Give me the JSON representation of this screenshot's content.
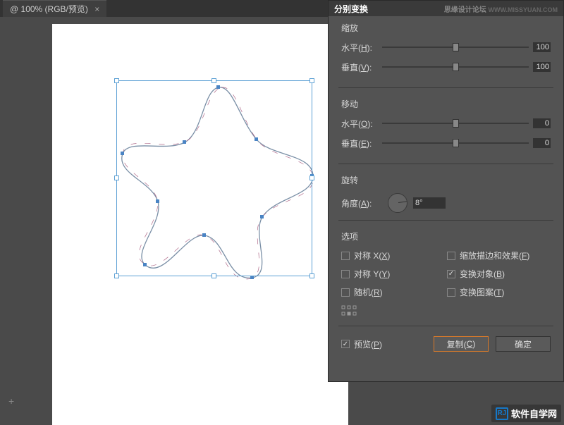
{
  "tab": {
    "title": "@ 100% (RGB/预览)",
    "close": "×"
  },
  "dialog": {
    "title": "分别变换",
    "watermark": "思缘设计论坛",
    "watermark_url": "WWW.MISSYUAN.COM",
    "scale": {
      "title": "缩放",
      "h_label": "水平(",
      "h_key": "H",
      "close": "):",
      "h_value": "100",
      "v_label": "垂直(",
      "v_key": "V",
      "v_value": "100"
    },
    "move": {
      "title": "移动",
      "h_label": "水平(",
      "h_key": "O",
      "close": "):",
      "h_value": "0",
      "v_label": "垂直(",
      "v_key": "E",
      "v_value": "0"
    },
    "rotate": {
      "title": "旋转",
      "label": "角度(",
      "key": "A",
      "close": "):",
      "value": "8°"
    },
    "options": {
      "title": "选项",
      "reflect_x": "对称 X(",
      "reflect_x_key": "X",
      "reflect_x_close": ")",
      "scale_strokes": "缩放描边和效果(",
      "scale_strokes_key": "F",
      "scale_strokes_close": ")",
      "reflect_y": "对称 Y(",
      "reflect_y_key": "Y",
      "reflect_y_close": ")",
      "transform_objects": "变换对象(",
      "transform_objects_key": "B",
      "transform_objects_close": ")",
      "random": "随机(",
      "random_key": "R",
      "random_close": ")",
      "transform_patterns": "变换图案(",
      "transform_patterns_key": "T",
      "transform_patterns_close": ")"
    },
    "preview": "预览(",
    "preview_key": "P",
    "preview_close": ")",
    "copy_btn": "复制(",
    "copy_key": "C",
    "copy_close": ")",
    "ok_btn": "确定"
  },
  "corner": {
    "logo": "RJ",
    "text": "软件自学网"
  }
}
